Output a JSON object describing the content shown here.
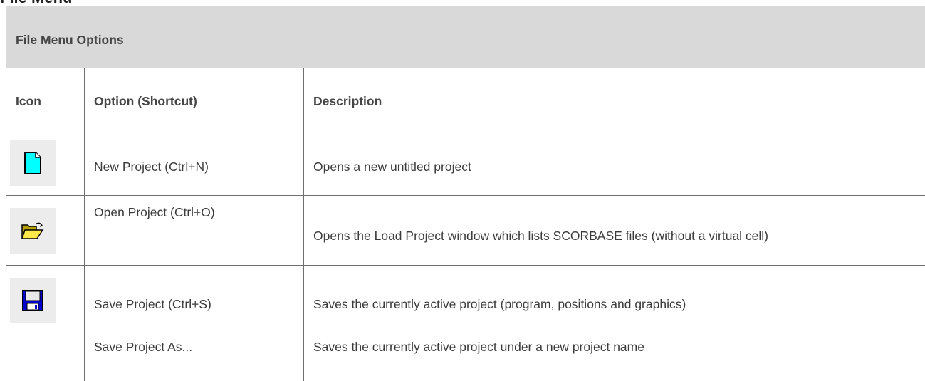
{
  "cut_heading": "File Menu",
  "table": {
    "title": "File Menu Options",
    "headers": {
      "icon": "Icon",
      "option": "Option (Shortcut)",
      "description": "Description"
    },
    "rows": [
      {
        "icon": "new-document-icon",
        "option": "New Project (Ctrl+N)",
        "description": "Opens a new untitled project"
      },
      {
        "icon": "open-folder-icon",
        "option": "Open Project (Ctrl+O)",
        "description": "Opens the Load Project window which lists SCORBASE files (without a virtual cell)"
      },
      {
        "icon": "floppy-disk-icon",
        "option": "Save Project (Ctrl+S)",
        "description": "Saves the currently active project (program, positions and graphics)"
      },
      {
        "icon": "",
        "option": "Save Project As...",
        "description": "Saves the currently active project under a new project name"
      }
    ]
  },
  "colors": {
    "title_band": "#d9d9d9",
    "border": "#6e6e6e",
    "icon_bg": "#ececec",
    "new_icon": "#00ffff",
    "save_icon": "#0000cc"
  }
}
